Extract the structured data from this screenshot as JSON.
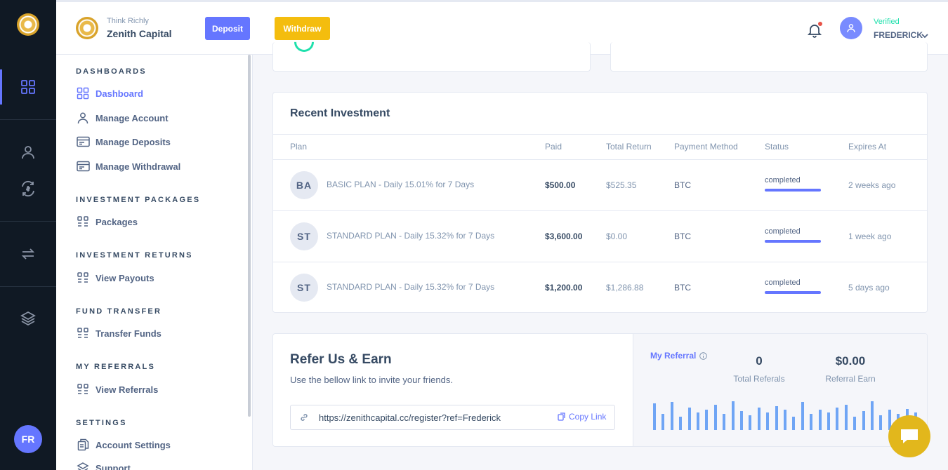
{
  "header": {
    "tagline": "Think Richly",
    "brand": "Zenith Capital",
    "deposit_label": "Deposit",
    "withdraw_label": "Withdraw",
    "user_status": "Verified",
    "user_name": "FREDERICK"
  },
  "rail": {
    "avatar_initials": "FR"
  },
  "menu": {
    "sections": [
      {
        "heading": "DASHBOARDS",
        "items": [
          "Dashboard",
          "Manage Account",
          "Manage Deposits",
          "Manage Withdrawal"
        ]
      },
      {
        "heading": "INVESTMENT PACKAGES",
        "items": [
          "Packages"
        ]
      },
      {
        "heading": "INVESTMENT RETURNS",
        "items": [
          "View Payouts"
        ]
      },
      {
        "heading": "FUND TRANSFER",
        "items": [
          "Transfer Funds"
        ]
      },
      {
        "heading": "MY REFERRALS",
        "items": [
          "View Referrals"
        ]
      },
      {
        "heading": "SETTINGS",
        "items": [
          "Account Settings",
          "Support"
        ]
      }
    ]
  },
  "investments": {
    "title": "Recent Investment",
    "columns": [
      "Plan",
      "Paid",
      "Total Return",
      "Payment Method",
      "Status",
      "Expires At"
    ],
    "rows": [
      {
        "badge": "BA",
        "plan": "BASIC PLAN - Daily 15.01% for 7 Days",
        "paid": "$500.00",
        "total_return": "$525.35",
        "method": "BTC",
        "status": "completed",
        "expires": "2 weeks ago"
      },
      {
        "badge": "ST",
        "plan": "STANDARD PLAN - Daily 15.32% for 7 Days",
        "paid": "$3,600.00",
        "total_return": "$0.00",
        "method": "BTC",
        "status": "completed",
        "expires": "1 week ago"
      },
      {
        "badge": "ST",
        "plan": "STANDARD PLAN - Daily 15.32% for 7 Days",
        "paid": "$1,200.00",
        "total_return": "$1,286.88",
        "method": "BTC",
        "status": "completed",
        "expires": "5 days ago"
      }
    ]
  },
  "refer": {
    "title": "Refer Us & Earn",
    "subtitle": "Use the bellow link to invite your friends.",
    "link": "https://zenithcapital.cc/register?ref=Frederick",
    "copy_label": "Copy Link",
    "my_referral": "My Referral",
    "total_referrals_value": "0",
    "total_referrals_label": "Total Referals",
    "referral_earn_value": "$0.00",
    "referral_earn_label": "Referral Earn",
    "bar_levels": [
      0.9,
      0.55,
      0.95,
      0.45,
      0.75,
      0.6,
      0.7,
      0.85,
      0.55,
      0.98,
      0.65,
      0.5,
      0.75,
      0.6,
      0.8,
      0.7,
      0.45,
      0.95,
      0.55,
      0.7,
      0.6,
      0.75,
      0.85,
      0.45,
      0.65,
      0.98,
      0.5,
      0.7,
      0.55,
      0.72,
      0.6
    ]
  },
  "colors": {
    "primary": "#6576ff",
    "warning": "#f4bd0e",
    "success": "#1ee0ac",
    "rail": "#101924"
  },
  "icons": {
    "rail": [
      "dashboard-icon",
      "user-icon",
      "exchange-icon",
      "transfer-icon",
      "layers-icon"
    ],
    "header": [
      "bell-icon",
      "user-icon",
      "chevron-down-icon"
    ],
    "chat": "chat-icon"
  }
}
